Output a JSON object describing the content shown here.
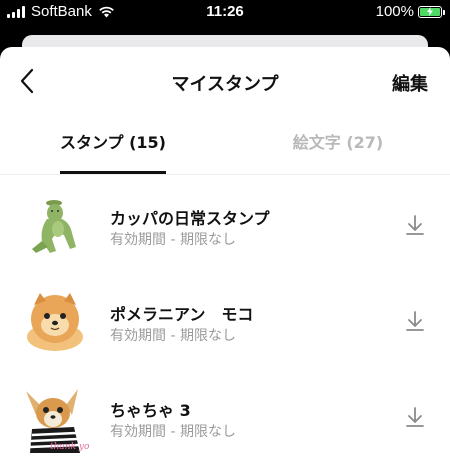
{
  "status_bar": {
    "carrier": "SoftBank",
    "time": "11:26",
    "battery": "100%",
    "battery_level": 1.0,
    "colors": {
      "battery": "#4cd964"
    }
  },
  "header": {
    "back_icon": "chevron-left-icon",
    "title": "マイスタンプ",
    "edit_label": "編集"
  },
  "tabs": [
    {
      "label": "スタンプ (15)",
      "active": true
    },
    {
      "label": "絵文字 (27)",
      "active": false
    }
  ],
  "stamps": [
    {
      "name": "カッパの日常スタンプ",
      "period": "有効期間 - 期限なし",
      "thumb_icon": "kappa-sticker-image",
      "action_icon": "download-icon"
    },
    {
      "name": "ポメラニアン　モコ",
      "period": "有効期間 - 期限なし",
      "thumb_icon": "pomeranian-sticker-image",
      "action_icon": "download-icon"
    },
    {
      "name": "ちゃちゃ 3",
      "period": "有効期間 - 期限なし",
      "thumb_icon": "chihuahua-sticker-image",
      "action_icon": "download-icon"
    }
  ],
  "thumb_text": {
    "chihuahua_sticker": "thank you!"
  }
}
